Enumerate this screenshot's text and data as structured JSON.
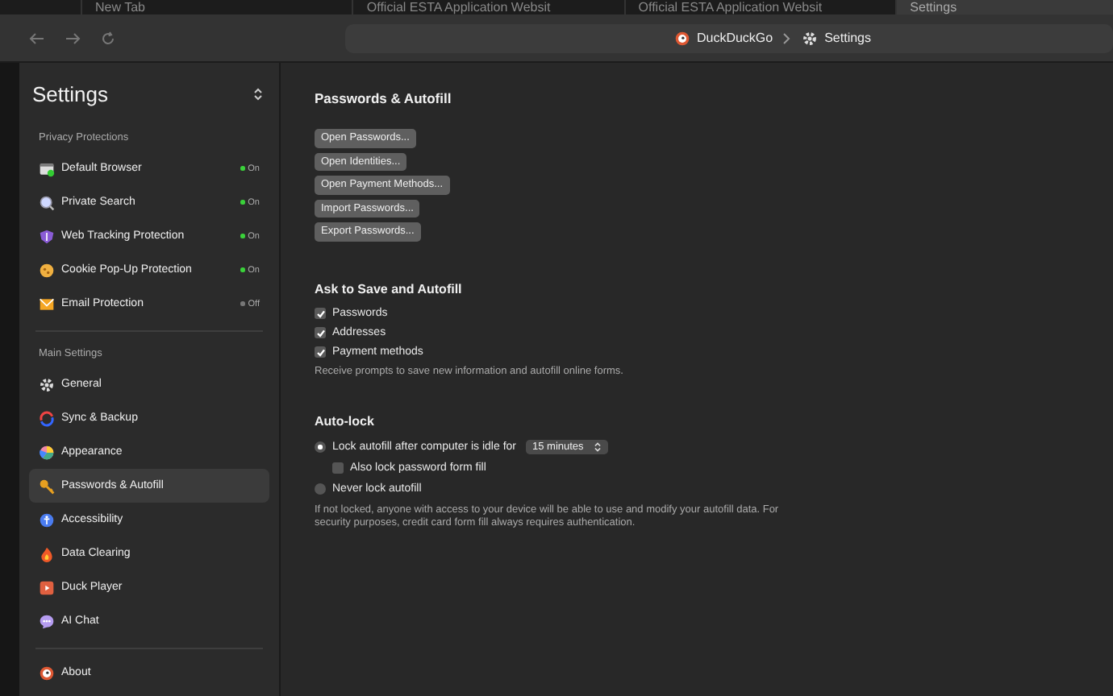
{
  "tabs": [
    {
      "title": "New Tab",
      "selected": false
    },
    {
      "title": "Official ESTA Application Websit",
      "selected": false
    },
    {
      "title": "Official ESTA Application Websit",
      "selected": false
    },
    {
      "title": "Settings",
      "selected": true
    }
  ],
  "address_bar": {
    "site": "DuckDuckGo",
    "page": "Settings"
  },
  "sidebar": {
    "title": "Settings",
    "sections": [
      {
        "heading": "Privacy Protections",
        "items": [
          {
            "label": "Default Browser",
            "selected": false,
            "status": "On",
            "on": true
          },
          {
            "label": "Private Search",
            "selected": false,
            "status": "On",
            "on": true
          },
          {
            "label": "Web Tracking Protection",
            "selected": false,
            "status": "On",
            "on": true
          },
          {
            "label": "Cookie Pop-Up Protection",
            "selected": false,
            "status": "On",
            "on": true
          },
          {
            "label": "Email Protection",
            "selected": false,
            "status": "Off",
            "on": false
          }
        ]
      },
      {
        "heading": "Main Settings",
        "items": [
          {
            "label": "General",
            "selected": false
          },
          {
            "label": "Sync & Backup",
            "selected": false
          },
          {
            "label": "Appearance",
            "selected": false
          },
          {
            "label": "Passwords & Autofill",
            "selected": true
          },
          {
            "label": "Accessibility",
            "selected": false
          },
          {
            "label": "Data Clearing",
            "selected": false
          },
          {
            "label": "Duck Player",
            "selected": false
          },
          {
            "label": "AI Chat",
            "selected": false
          }
        ]
      },
      {
        "items": [
          {
            "label": "About",
            "selected": false
          }
        ]
      }
    ]
  },
  "content": {
    "title": "Passwords & Autofill",
    "buttons": [
      "Open Passwords...",
      "Open Identities...",
      "Open Payment Methods...",
      "Import Passwords...",
      "Export Passwords..."
    ],
    "ask_section": {
      "title": "Ask to Save and Autofill",
      "options": [
        {
          "label": "Passwords",
          "checked": true
        },
        {
          "label": "Addresses",
          "checked": true
        },
        {
          "label": "Payment methods",
          "checked": true
        }
      ],
      "note": "Receive prompts to save new information and autofill online forms."
    },
    "autolock_section": {
      "title": "Auto-lock",
      "options": [
        {
          "kind": "radio",
          "label": "Lock autofill after computer is idle for",
          "selected": true,
          "dropdown": "15 minutes"
        },
        {
          "kind": "checkbox",
          "label": "Also lock password form fill",
          "checked": false
        },
        {
          "kind": "radio",
          "label": "Never lock autofill",
          "selected": false
        }
      ],
      "note": "If not locked, anyone with access to your device will be able to use and modify your autofill data. For security purposes, credit card form fill always requires authentication."
    }
  }
}
